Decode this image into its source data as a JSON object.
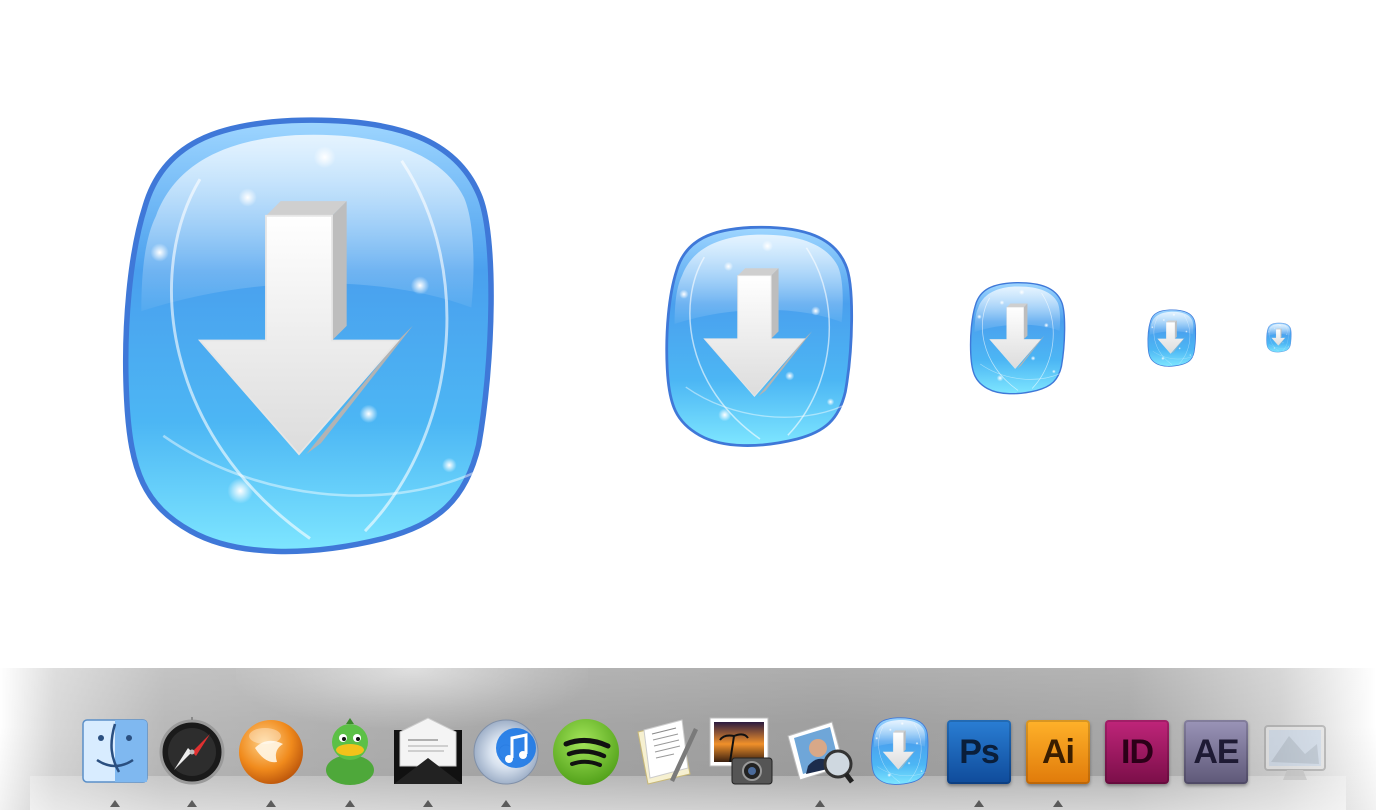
{
  "colors": {
    "cube_light": "#7ee0ff",
    "cube_mid": "#4aa8ee",
    "cube_dark": "#2e6fd8",
    "arrow": "#f0f0f0",
    "dock_gray": "#a9a9a9"
  },
  "preview_icons": [
    {
      "name": "download-icon"
    },
    {
      "name": "download-icon"
    },
    {
      "name": "download-icon"
    },
    {
      "name": "download-icon"
    },
    {
      "name": "download-icon"
    }
  ],
  "dock": {
    "items": [
      {
        "name": "finder-icon",
        "running": true
      },
      {
        "name": "safari-compass-icon",
        "running": true
      },
      {
        "name": "firefox-like-orange-globe-icon",
        "running": true
      },
      {
        "name": "adium-duck-icon",
        "running": true
      },
      {
        "name": "mail-envelope-icon",
        "running": true
      },
      {
        "name": "itunes-icon",
        "running": true
      },
      {
        "name": "spotify-icon",
        "running": false
      },
      {
        "name": "textedit-icon",
        "running": false
      },
      {
        "name": "iphoto-icon",
        "running": false
      },
      {
        "name": "preview-icon",
        "running": true
      },
      {
        "name": "download-icon",
        "running": false
      },
      {
        "name": "photoshop-icon",
        "running": true
      },
      {
        "name": "illustrator-icon",
        "running": true
      },
      {
        "name": "indesign-icon",
        "running": false
      },
      {
        "name": "after-effects-icon",
        "running": false
      },
      {
        "name": "monitor-icon",
        "running": false
      }
    ],
    "adobe_labels": {
      "photoshop": "Ps",
      "illustrator": "Ai",
      "indesign": "ID",
      "after_effects": "AE"
    }
  }
}
